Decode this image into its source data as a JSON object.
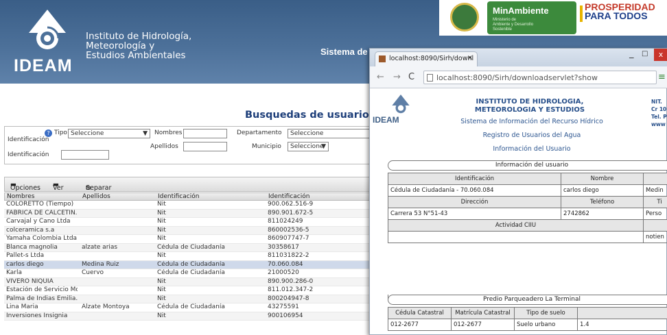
{
  "header": {
    "logo_word": "IDEAM",
    "institute_lines": [
      "Instituto de Hidrología,",
      "Meteorología y",
      "Estudios Ambientales"
    ],
    "system_title": "Sistema de",
    "minambiente": "MinAmbiente",
    "minambiente_sub": "Ministerio de Ambiente y Desarrollo Sostenible",
    "prosperidad": [
      "PROSPERIDAD",
      "PARA TODOS"
    ]
  },
  "search": {
    "title": "Busquedas de usuario",
    "tipo_label": "Tipo",
    "identificacion_label": "Identificación",
    "tipo_value": "Seleccione",
    "identificacion2_label": "Identificación",
    "nombres_label": "Nombres",
    "apellidos_label": "Apellidos",
    "departamento_label": "Departamento",
    "departamento_value": "Seleccione",
    "municipio_label": "Municipio",
    "municipio_value": "Seleccione"
  },
  "toolbar": {
    "opciones": "Opciones",
    "ver": "Ver",
    "separar": "Separar"
  },
  "table": {
    "headers": [
      "Nombres",
      "Apellidos",
      "Identificación",
      "Identificación"
    ],
    "rows": [
      [
        "COLORETTO (Tiempo)",
        "",
        "Nit",
        "900.062.516-9"
      ],
      [
        "FABRICA DE CALCETIN...",
        "",
        "Nit",
        "890.901.672-5"
      ],
      [
        "Carvajal y Cano Ltda",
        "",
        "Nit",
        "811024249"
      ],
      [
        "colceramica s.a",
        "",
        "Nit",
        "860002536-5"
      ],
      [
        "Yamaha Colombia Ltda",
        "",
        "Nit",
        "860907747-7"
      ],
      [
        "Blanca magnolia",
        "alzate arias",
        "Cédula de Ciudadanía",
        "30358617"
      ],
      [
        "Pallet-s Ltda",
        "",
        "Nit",
        "811031822-2"
      ],
      [
        "carlos diego",
        "Medina Ruiz",
        "Cédula de Ciudadanía",
        "70.060.084"
      ],
      [
        "Karla",
        "Cuervo",
        "Cédula de Ciudadanía",
        "21000520"
      ],
      [
        "VIVERO NIQUIA",
        "",
        "Nit",
        "890.900.286-0"
      ],
      [
        "Estación de Servicio Mo...",
        "",
        "Nit",
        "811.012.347-2"
      ],
      [
        "Palma de Indias Emilia...",
        "",
        "Nit",
        "800204947-8"
      ],
      [
        "Lina Maria",
        "Alzate Montoya",
        "Cédula de Ciudadanía",
        "43275591"
      ],
      [
        "Inversiones Insignia",
        "",
        "Nit",
        "900106954"
      ]
    ],
    "selected_row": 7
  },
  "browser": {
    "tab_title": "localhost:8090/Sirh/downl",
    "url": "localhost:8090/Sirh/downloadservlet?show",
    "minimize": "_",
    "maximize": "□",
    "close": "x"
  },
  "report": {
    "institute": [
      "INSTITUTO DE HIDROLOGIA,",
      "METEOROLOGIA Y ESTUDIOS"
    ],
    "system": "Sistema de Información del Recurso Hídrico",
    "registry": "Registro de Usuarios del Agua",
    "info": "Información del Usuario",
    "nit": [
      "NIT.",
      "Cr 10",
      "Tel. P",
      "www"
    ],
    "section_user": "Información del usuario",
    "h_ident": "Identificación",
    "h_nombre": "Nombre",
    "v_ident": "Cédula de Ciudadanía - 70.060.084",
    "v_nombre": "carlos diego",
    "v_extra1": "Medin",
    "h_direccion": "Dirección",
    "h_telefono": "Teléfono",
    "h_extra2": "Ti",
    "v_direccion": "Carrera 53 N°51-43",
    "v_telefono": "2742862",
    "v_extra2": "Perso",
    "h_actividad": "Actividad CIIU",
    "v_extra3": "notien",
    "section_predio": "Predio Parqueadero La Terminal",
    "h_cedula_cat": "Cédula Catastral",
    "h_matricula": "Matrícula Catastral",
    "h_tipo_suelo": "Tipo de suelo",
    "v_cedula_cat": "012-2677",
    "v_matricula": "012-2677",
    "v_tipo_suelo": "Suelo urbano",
    "v_extra4": "1.4"
  }
}
